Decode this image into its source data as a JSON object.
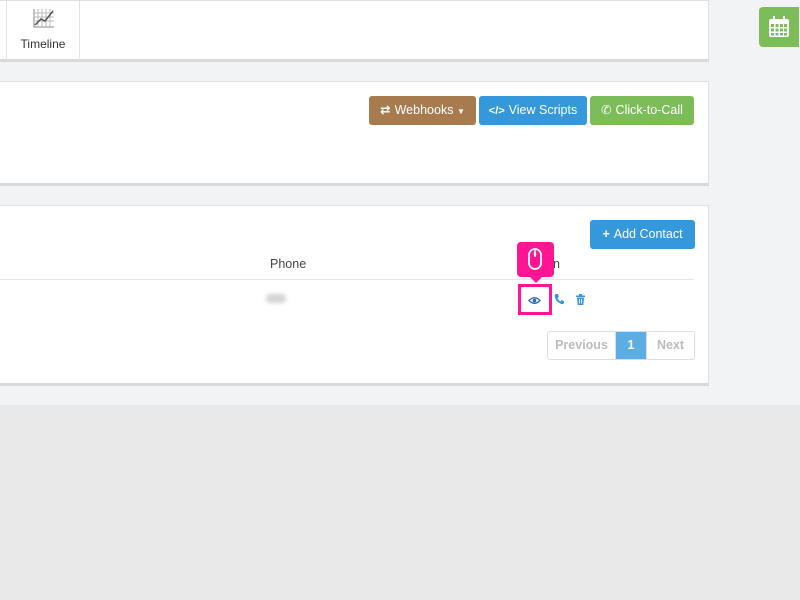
{
  "header": {
    "timeline_label": "Timeline"
  },
  "actions": {
    "webhooks_label": "Webhooks",
    "view_scripts_label": "View Scripts",
    "click_to_call_label": "Click-to-Call"
  },
  "contacts": {
    "add_contact_label": "Add Contact",
    "columns": {
      "phone": "Phone",
      "action_visible": "n"
    },
    "pagination": {
      "previous": "Previous",
      "current_page": "1",
      "next": "Next"
    }
  },
  "icons": {
    "timeline": "timeline-chart-icon",
    "calendar": "calendar-icon",
    "view": "eye-icon",
    "call": "phone-icon",
    "delete": "trash-icon",
    "mouse": "mouse-icon"
  },
  "colors": {
    "webhooks_button": "#a87b4f",
    "primary_button": "#3498db",
    "success_button": "#7cbd5a",
    "highlight": "#ff1493",
    "active_page": "#5dade2"
  }
}
